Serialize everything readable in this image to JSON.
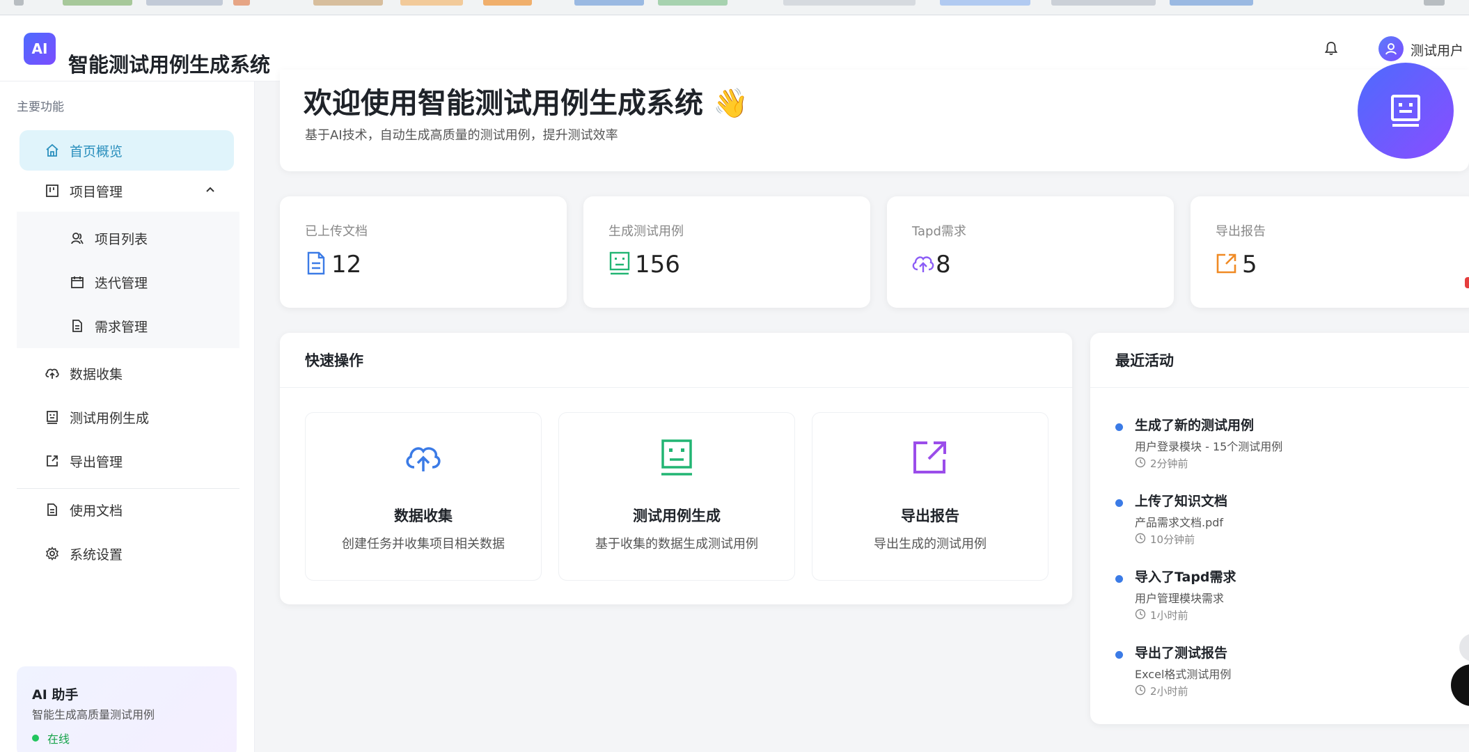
{
  "app": {
    "logo_text": "AI",
    "title": "智能测试用例生成系统",
    "user_name": "测试用户"
  },
  "sidebar": {
    "section_label": "主要功能",
    "items": [
      {
        "label": "首页概览",
        "icon": "home-icon"
      },
      {
        "label": "项目管理",
        "icon": "project-board-icon"
      },
      {
        "label": "项目列表",
        "icon": "users-icon"
      },
      {
        "label": "迭代管理",
        "icon": "calendar-icon"
      },
      {
        "label": "需求管理",
        "icon": "document-icon"
      },
      {
        "label": "数据收集",
        "icon": "cloud-upload-icon"
      },
      {
        "label": "测试用例生成",
        "icon": "robot-icon"
      },
      {
        "label": "导出管理",
        "icon": "export-icon"
      },
      {
        "label": "使用文档",
        "icon": "document-icon"
      },
      {
        "label": "系统设置",
        "icon": "gear-icon"
      }
    ],
    "ai_card": {
      "title": "AI 助手",
      "subtitle": "智能生成高质量测试用例",
      "status": "在线"
    }
  },
  "welcome": {
    "title": "欢迎使用智能测试用例生成系统 👋",
    "subtitle": "基于AI技术，自动生成高质量的测试用例，提升测试效率"
  },
  "stats": [
    {
      "label": "已上传文档",
      "value": "12",
      "icon": "document-icon",
      "color": "#3b7be6"
    },
    {
      "label": "生成测试用例",
      "value": "156",
      "icon": "robot-icon",
      "color": "#22b573"
    },
    {
      "label": "Tapd需求",
      "value": "8",
      "icon": "cloud-upload-icon",
      "color": "#8b5cf6"
    },
    {
      "label": "导出报告",
      "value": "5",
      "icon": "export-icon",
      "color": "#f08a24"
    }
  ],
  "quick_actions": {
    "title": "快速操作",
    "cards": [
      {
        "title": "数据收集",
        "desc": "创建任务并收集项目相关数据",
        "icon": "cloud-upload-icon",
        "color": "#3b7be6"
      },
      {
        "title": "测试用例生成",
        "desc": "基于收集的数据生成测试用例",
        "icon": "robot-icon",
        "color": "#22b573"
      },
      {
        "title": "导出报告",
        "desc": "导出生成的测试用例",
        "icon": "export-icon",
        "color": "#9b4dea"
      }
    ]
  },
  "recent_activity": {
    "title": "最近活动",
    "items": [
      {
        "title": "生成了新的测试用例",
        "desc": "用户登录模块 - 15个测试用例",
        "time": "2分钟前"
      },
      {
        "title": "上传了知识文档",
        "desc": "产品需求文档.pdf",
        "time": "10分钟前"
      },
      {
        "title": "导入了Tapd需求",
        "desc": "用户管理模块需求",
        "time": "1小时前"
      },
      {
        "title": "导出了测试报告",
        "desc": "Excel格式测试用例",
        "time": "2小时前"
      }
    ]
  },
  "colors": {
    "brand_gradient_start": "#4d6bfe",
    "brand_gradient_end": "#8a4dff",
    "active_menu_bg": "#e0f4fb",
    "active_menu_text": "#2a8fbd",
    "online": "#22c55e"
  }
}
